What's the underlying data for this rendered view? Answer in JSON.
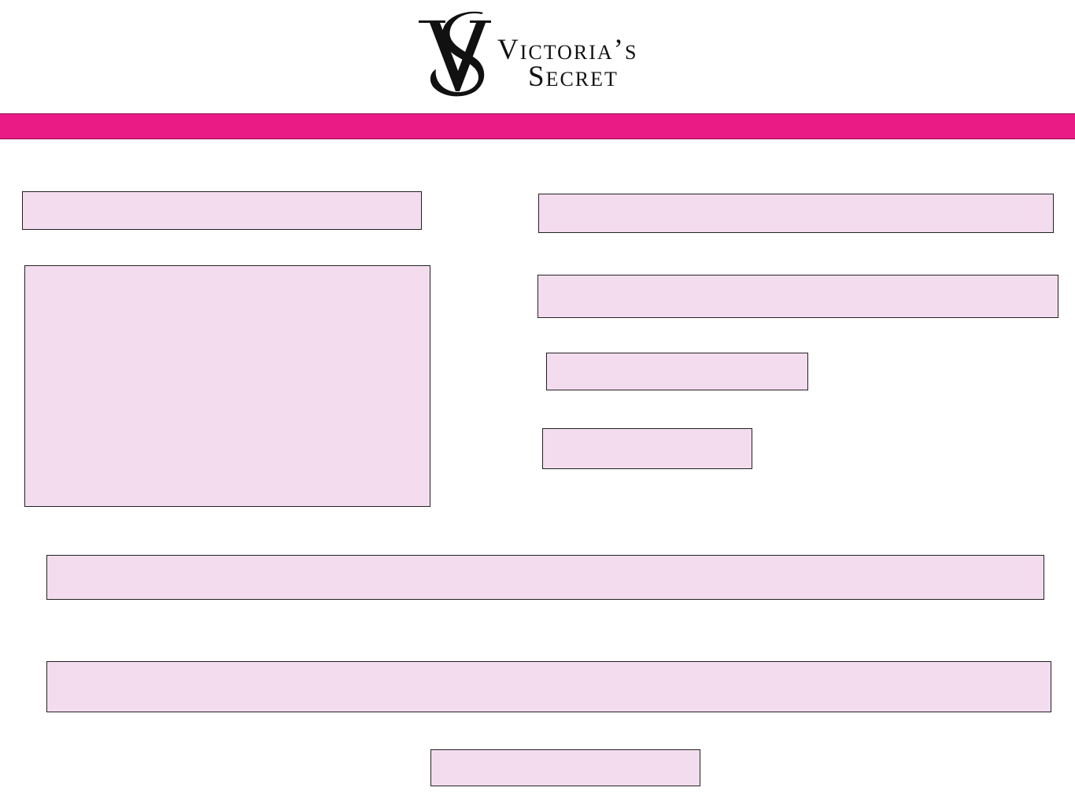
{
  "brand": {
    "logo_line1": "Victoria’s",
    "logo_line2": "Secret",
    "monogram": "VS"
  },
  "colors": {
    "accent_bar": "#ea1b85",
    "placeholder_fill": "#f4dcef",
    "placeholder_border": "#222222",
    "logo_ink": "#111111"
  }
}
